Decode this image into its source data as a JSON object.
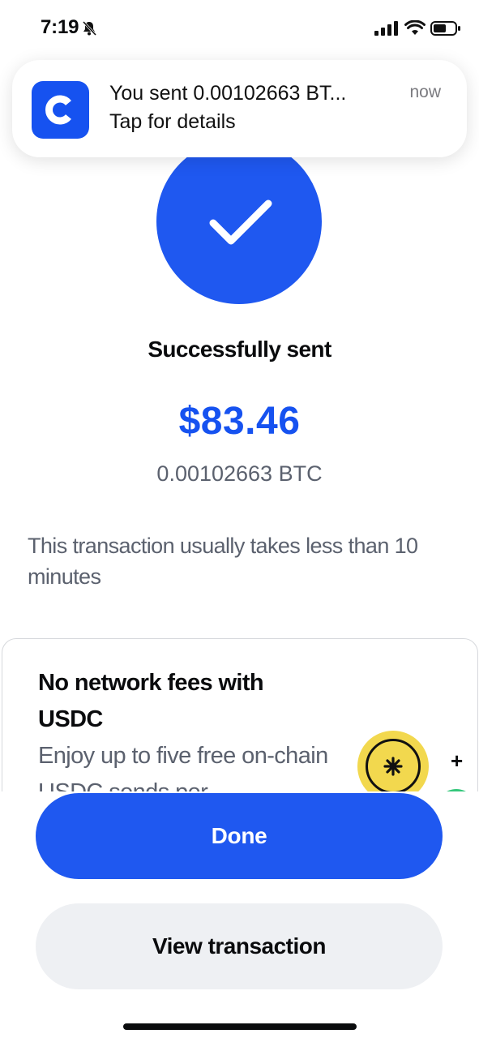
{
  "status_bar": {
    "time": "7:19",
    "icons": [
      "bell-slash-icon",
      "cellular-signal-icon",
      "wifi-icon",
      "battery-icon"
    ]
  },
  "notification": {
    "app_icon": "coinbase-logo-icon",
    "title": "You sent 0.00102663 BT...",
    "subtitle": "Tap for details",
    "time": "now"
  },
  "success": {
    "icon": "checkmark-icon",
    "title": "Successfully sent",
    "amount_usd": "$83.46",
    "amount_btc": "0.00102663 BTC",
    "eta": "This transaction usually takes less than 10 minutes"
  },
  "promo": {
    "title": "No network fees with USDC",
    "body": "Enjoy up to five free on-chain USDC sends per",
    "plus": "+"
  },
  "actions": {
    "done_label": "Done",
    "view_transaction_label": "View transaction"
  },
  "colors": {
    "brand_blue": "#1652f0",
    "button_blue": "#1f58f0",
    "secondary_button": "#eef0f3",
    "muted_text": "#5b616e"
  }
}
